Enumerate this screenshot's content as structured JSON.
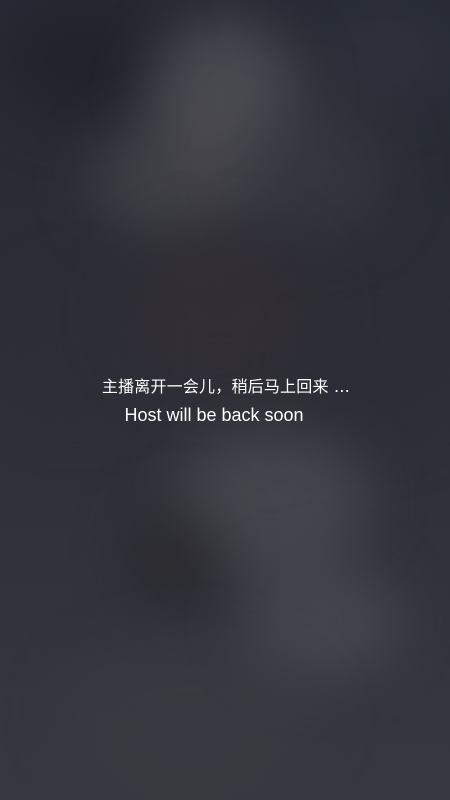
{
  "stream_status": {
    "message_cn": "主播离开一会儿，稍后马上回来 …",
    "message_en": "Host will be back soon"
  },
  "background": {
    "description": "blurred-video-frame"
  },
  "colors": {
    "text": "#ffffff",
    "background": "#2f323b"
  }
}
